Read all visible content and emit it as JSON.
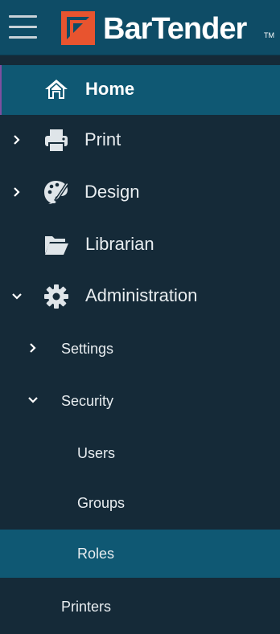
{
  "header": {
    "brand": "BarTender",
    "trademark": "TM"
  },
  "colors": {
    "header_bg": "#0e4c66",
    "sidebar_bg": "#152a38",
    "active_bg": "#0f5873",
    "logo_orange": "#e8542f"
  },
  "nav": {
    "home": {
      "label": "Home",
      "icon": "home-icon"
    },
    "print": {
      "label": "Print",
      "icon": "printer-icon"
    },
    "design": {
      "label": "Design",
      "icon": "palette-icon"
    },
    "librarian": {
      "label": "Librarian",
      "icon": "folder-icon"
    },
    "administration": {
      "label": "Administration",
      "icon": "gear-icon"
    },
    "settings": {
      "label": "Settings"
    },
    "security": {
      "label": "Security"
    },
    "users": {
      "label": "Users"
    },
    "groups": {
      "label": "Groups"
    },
    "roles": {
      "label": "Roles"
    },
    "printers": {
      "label": "Printers"
    }
  }
}
